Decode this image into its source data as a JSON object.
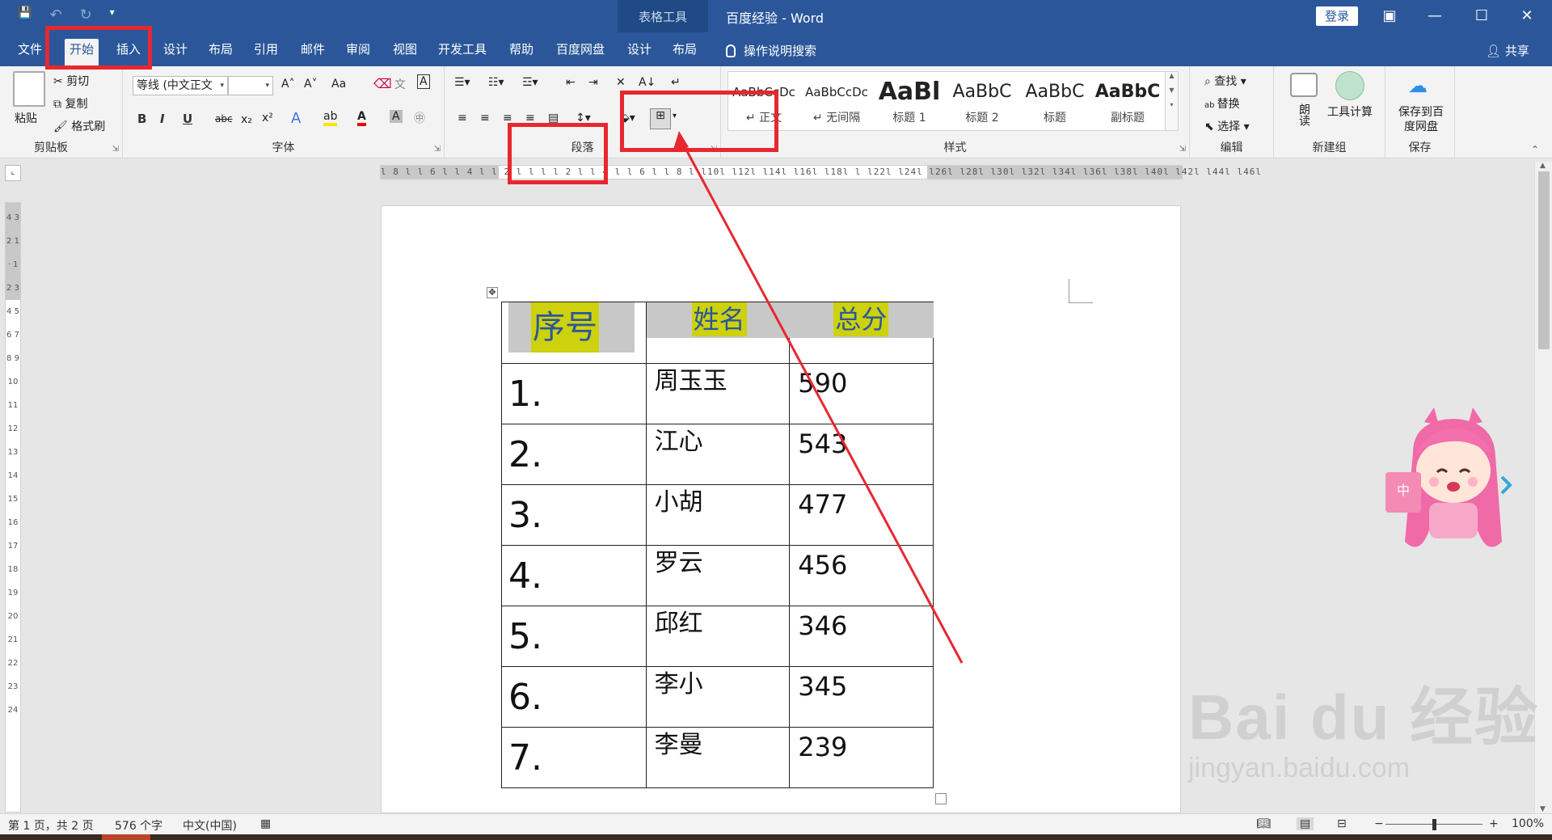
{
  "window": {
    "context_label": "表格工具",
    "title": "百度经验  -  Word",
    "login": "登录",
    "minimize": "—",
    "maximize": "☐",
    "close": "✕",
    "ribbon_display": "▣"
  },
  "qat": {
    "save": "💾",
    "undo": "↶",
    "redo": "↻",
    "customize": "▾"
  },
  "tabs": [
    "文件",
    "开始",
    "插入",
    "设计",
    "布局",
    "引用",
    "邮件",
    "审阅",
    "视图",
    "开发工具",
    "帮助",
    "百度网盘",
    "设计",
    "布局"
  ],
  "tell_me": "操作说明搜索",
  "share": "共享",
  "clipboard": {
    "paste": "粘贴",
    "cut": "剪切",
    "copy": "复制",
    "format_painter": "格式刷",
    "label": "剪贴板"
  },
  "font": {
    "name": "等线 (中文正文",
    "size": "",
    "grow": "A˄",
    "shrink": "A˅",
    "case": "Aa",
    "bold": "B",
    "italic": "I",
    "underline": "U",
    "strike": "abc",
    "subscript": "x₂",
    "superscript": "x²",
    "label": "字体"
  },
  "paragraph": {
    "label": "段落"
  },
  "styles": {
    "label": "样式",
    "items": [
      {
        "sample": "AaBbCcDc",
        "name": "↵ 正文"
      },
      {
        "sample": "AaBbCcDc",
        "name": "↵ 无间隔"
      },
      {
        "sample": "AaBl",
        "name": "标题 1"
      },
      {
        "sample": "AaBbC",
        "name": "标题 2"
      },
      {
        "sample": "AaBbC",
        "name": "标题"
      },
      {
        "sample": "AaBbC",
        "name": "副标题"
      }
    ]
  },
  "editing": {
    "find": "查找",
    "replace": "替换",
    "select": "选择",
    "label": "编辑"
  },
  "new_group": {
    "read": "朗读",
    "calc": "工具计算",
    "label": "新建组"
  },
  "save_group": {
    "save_to_baidu": "保存到百度网盘",
    "label": "保存"
  },
  "ruler": {
    "h_ticks": "l 8 l  l 6 l  l 4 l  l 2 l  l  l  l 2 l  l 4 l  l 6 l  l 8 l  l10l  l12l  l14l  l16l  l18l  l  l22l  l24l  l26l  l28l  l30l  l32l  l34l  l36l  l38l  l40l  l42l  l44l  l46l",
    "v_ticks": "4 3 2 1 · 1 2 3 4 5 6 7 8 9 10 11 12 13 14 15 16 17 18 19 20 21 22 23 24"
  },
  "table": {
    "headers": [
      "序号",
      "姓名",
      "总分"
    ],
    "rows": [
      {
        "no": "1.",
        "name": "周玉玉",
        "score": "590"
      },
      {
        "no": "2.",
        "name": "江心",
        "score": "543"
      },
      {
        "no": "3.",
        "name": "小胡",
        "score": "477"
      },
      {
        "no": "4.",
        "name": "罗云",
        "score": "456"
      },
      {
        "no": "5.",
        "name": "邱红",
        "score": "346"
      },
      {
        "no": "6.",
        "name": "李小",
        "score": "345"
      },
      {
        "no": "7.",
        "name": "李曼",
        "score": "239"
      }
    ],
    "header_highlight": "#cdd10e",
    "header_text_color": "#2b579a"
  },
  "watermark": {
    "brand": "Bai du 经验",
    "url": "jingyan.baidu.com"
  },
  "status": {
    "page": "第 1 页，共 2 页",
    "words": "576 个字",
    "language": "中文(中国)",
    "zoom": "100%"
  },
  "colors": {
    "accent": "#2b579a",
    "annotation": "#e8272f"
  }
}
